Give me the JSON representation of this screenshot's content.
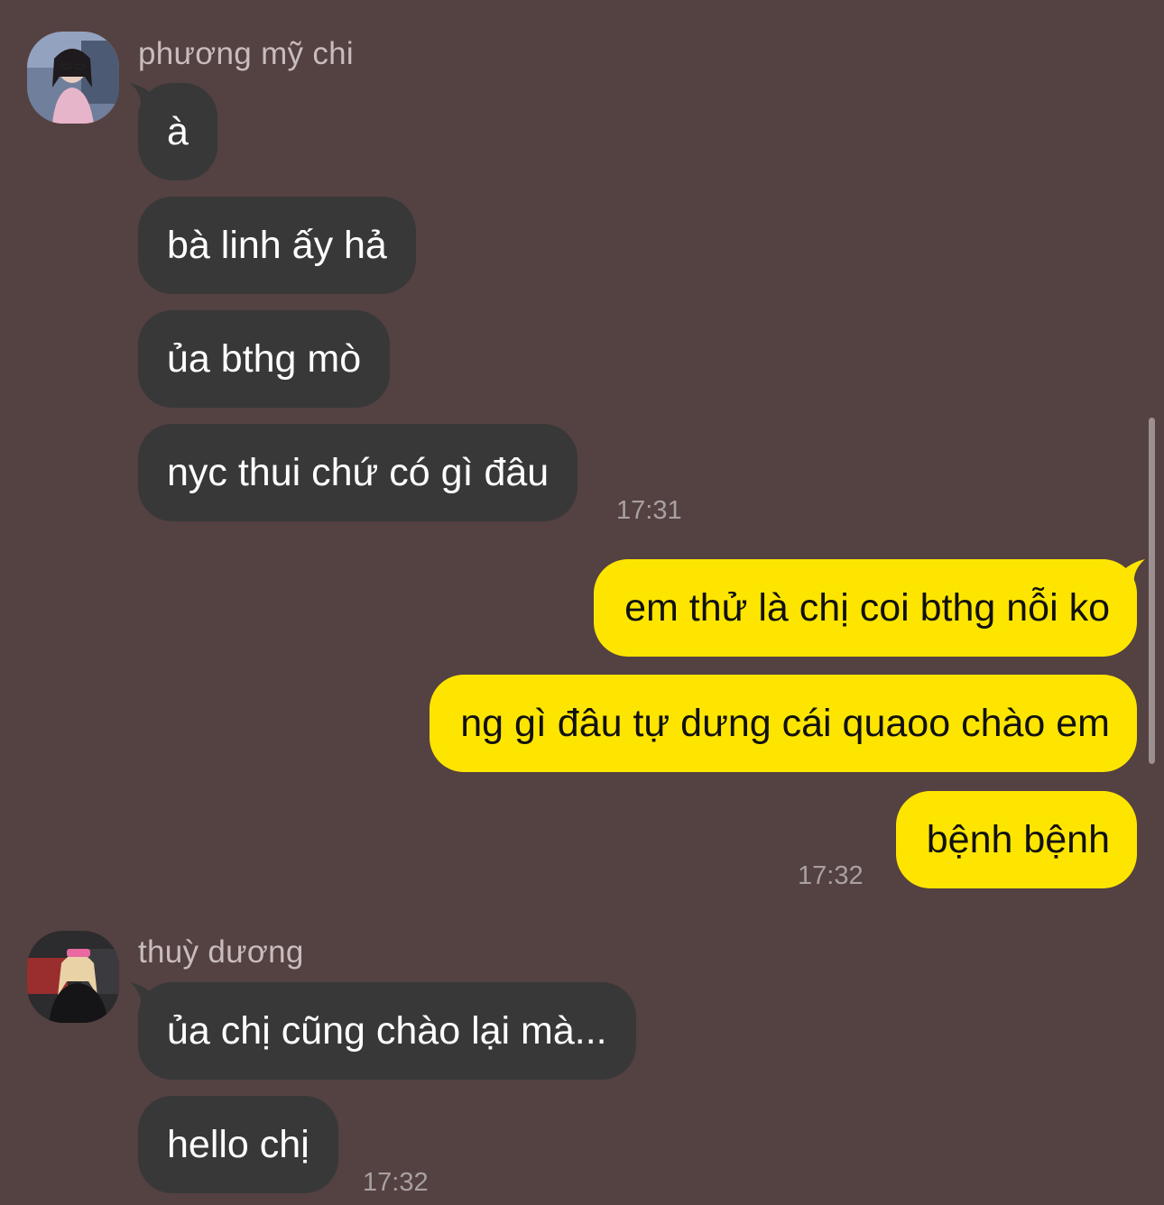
{
  "colors": {
    "background": "#544141",
    "incoming_bubble": "#383838",
    "outgoing_bubble": "#fee500",
    "sender_name": "#c9bcbc",
    "timestamp": "#a9a0a0"
  },
  "groups": [
    {
      "sender": "phương mỹ chi",
      "avatar": "avatar-photo",
      "messages": [
        "à",
        "bà linh ấy hả",
        "ủa bthg mò",
        "nyc thui chứ có gì đâu"
      ],
      "time": "17:31"
    },
    {
      "sender": "me",
      "messages": [
        "em thử là chị coi bthg nỗi ko",
        "ng gì đâu tự dưng cái quaoo chào em",
        "bệnh bệnh"
      ],
      "time": "17:32"
    },
    {
      "sender": "thuỳ dương",
      "avatar": "avatar-photo",
      "messages": [
        "ủa chị cũng chào lại mà...",
        "hello chị"
      ],
      "time": "17:32"
    }
  ]
}
